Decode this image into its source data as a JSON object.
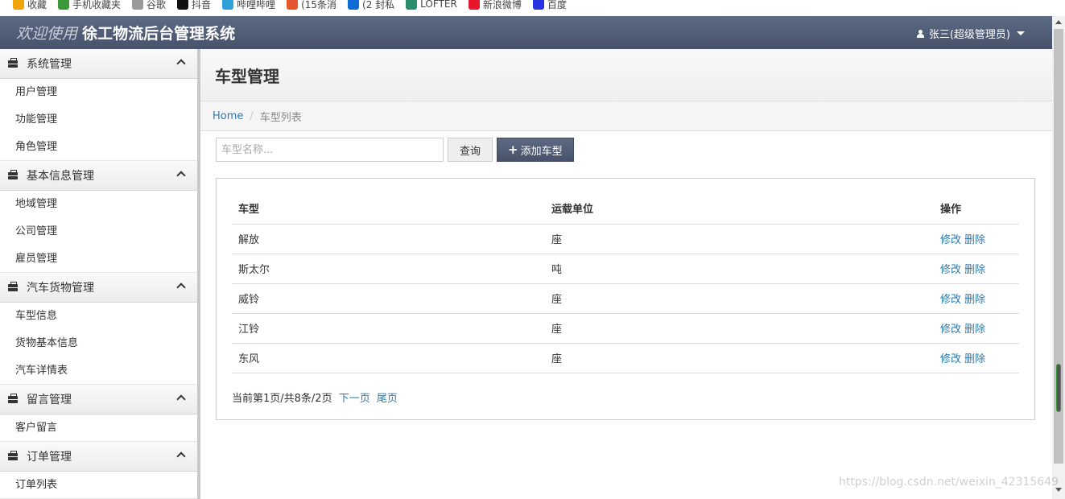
{
  "bookmarks": [
    {
      "label": "收藏",
      "icon": "star-icon",
      "color": "#f0a30a"
    },
    {
      "label": "手机收藏夹",
      "icon": "phone-icon",
      "color": "#3a9a3a"
    },
    {
      "label": "谷歌",
      "icon": "page-icon",
      "color": "#999999"
    },
    {
      "label": "抖音",
      "icon": "tiktok-icon",
      "color": "#111111"
    },
    {
      "label": "哔哩哔哩",
      "icon": "bilibili-icon",
      "color": "#2ea2d8"
    },
    {
      "label": "(15条消",
      "icon": "csdn-icon",
      "color": "#e4572e"
    },
    {
      "label": "(2 封私",
      "icon": "zhihu-icon",
      "color": "#0f6ad6"
    },
    {
      "label": "LOFTER",
      "icon": "lofter-icon",
      "color": "#2b8e6e"
    },
    {
      "label": "新浪微博",
      "icon": "weibo-icon",
      "color": "#e6162d"
    },
    {
      "label": "百度",
      "icon": "baidu-icon",
      "color": "#2932e1"
    }
  ],
  "header": {
    "welcome": "欢迎使用",
    "system_name": "徐工物流后台管理系统",
    "user": "张三(超级管理员)"
  },
  "sidebar": {
    "groups": [
      {
        "title": "系统管理",
        "items": [
          "用户管理",
          "功能管理",
          "角色管理"
        ]
      },
      {
        "title": "基本信息管理",
        "items": [
          "地域管理",
          "公司管理",
          "雇员管理"
        ]
      },
      {
        "title": "汽车货物管理",
        "items": [
          "车型信息",
          "货物基本信息",
          "汽车详情表"
        ]
      },
      {
        "title": "留言管理",
        "items": [
          "客户留言"
        ]
      },
      {
        "title": "订单管理",
        "items": [
          "订单列表"
        ]
      }
    ]
  },
  "page": {
    "title": "车型管理",
    "breadcrumb": {
      "home": "Home",
      "current": "车型列表"
    }
  },
  "toolbar": {
    "search_placeholder": "车型名称...",
    "query_label": "查询",
    "add_label": "添加车型"
  },
  "table": {
    "headers": [
      "车型",
      "运载单位",
      "操作"
    ],
    "rows": [
      {
        "model": "解放",
        "unit": "座"
      },
      {
        "model": "斯太尔",
        "unit": "吨"
      },
      {
        "model": "威铃",
        "unit": "座"
      },
      {
        "model": "江铃",
        "unit": "座"
      },
      {
        "model": "东风",
        "unit": "座"
      }
    ],
    "edit_label": "修改",
    "delete_label": "删除"
  },
  "pagination": {
    "status": "当前第1页/共8条/2页",
    "next": "下一页",
    "last": "尾页"
  },
  "watermark": "https://blog.csdn.net/weixin_42315649"
}
